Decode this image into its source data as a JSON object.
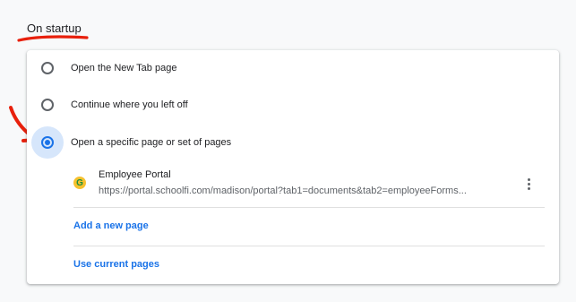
{
  "section": {
    "title": "On startup"
  },
  "options": [
    {
      "label": "Open the New Tab page",
      "selected": false
    },
    {
      "label": "Continue where you left off",
      "selected": false
    },
    {
      "label": "Open a specific page or set of pages",
      "selected": true
    }
  ],
  "pages": [
    {
      "name": "Employee Portal",
      "url": "https://portal.schoolfi.com/madison/portal?tab1=documents&tab2=employeeForms...",
      "favicon_letter": "G"
    }
  ],
  "actions": {
    "add_new_page": "Add a new page",
    "use_current_pages": "Use current pages"
  },
  "colors": {
    "accent": "#1a73e8",
    "annotation_red": "#e8200c",
    "card_background": "#ffffff",
    "page_background": "#f8f9fa"
  },
  "icons": {
    "more": "more-vert-icon",
    "favicon": "site-favicon-icon"
  }
}
